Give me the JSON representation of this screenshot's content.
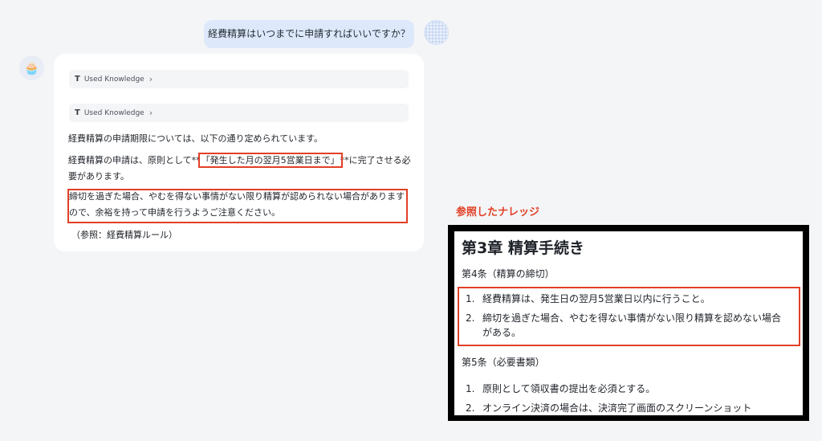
{
  "user_message": {
    "text": "経費精算はいつまでに申請すればいいですか？"
  },
  "bot": {
    "avatar_glyph": "🧁",
    "knowledge_chips": [
      {
        "icon": "T",
        "label": "Used Knowledge",
        "chevron": "›"
      },
      {
        "icon": "T",
        "label": "Used Knowledge",
        "chevron": "›"
      }
    ],
    "paragraph1": "経費精算の申請期限については、以下の通り定められています。",
    "paragraph2_pre": "経費精算の申請は、原則として**",
    "paragraph2_highlight": "「発生した月の翌月5営業日まで」",
    "paragraph2_post": "**に完了させる必要があります。",
    "paragraph3": "締切を過ぎた場合、やむを得ない事情がない限り精算が認められない場合がありますので、余裕を持って申請を行うようご注意ください。",
    "reference": "（参照：経費精算ルール）"
  },
  "knowledge_panel": {
    "caption": "参照したナレッジ",
    "heading": "第3章 精算手続き",
    "article1_title": "第4条（精算の締切）",
    "article1_items": [
      {
        "num": "1.",
        "text": "経費精算は、発生日の翌月5営業日以内に行うこと。"
      },
      {
        "num": "2.",
        "text": "締切を過ぎた場合、やむを得ない事情がない限り精算を認めない場合がある。"
      }
    ],
    "article2_title": "第5条（必要書類）",
    "article2_items": [
      {
        "num": "1.",
        "text": "原則として領収書の提出を必須とする。"
      },
      {
        "num": "2.",
        "text": "オンライン決済の場合は、決済完了画面のスクリーンショット"
      }
    ]
  },
  "colors": {
    "highlight_red": "#e24026",
    "user_bubble": "#dde9fb",
    "page_bg": "#f4f5f7"
  }
}
